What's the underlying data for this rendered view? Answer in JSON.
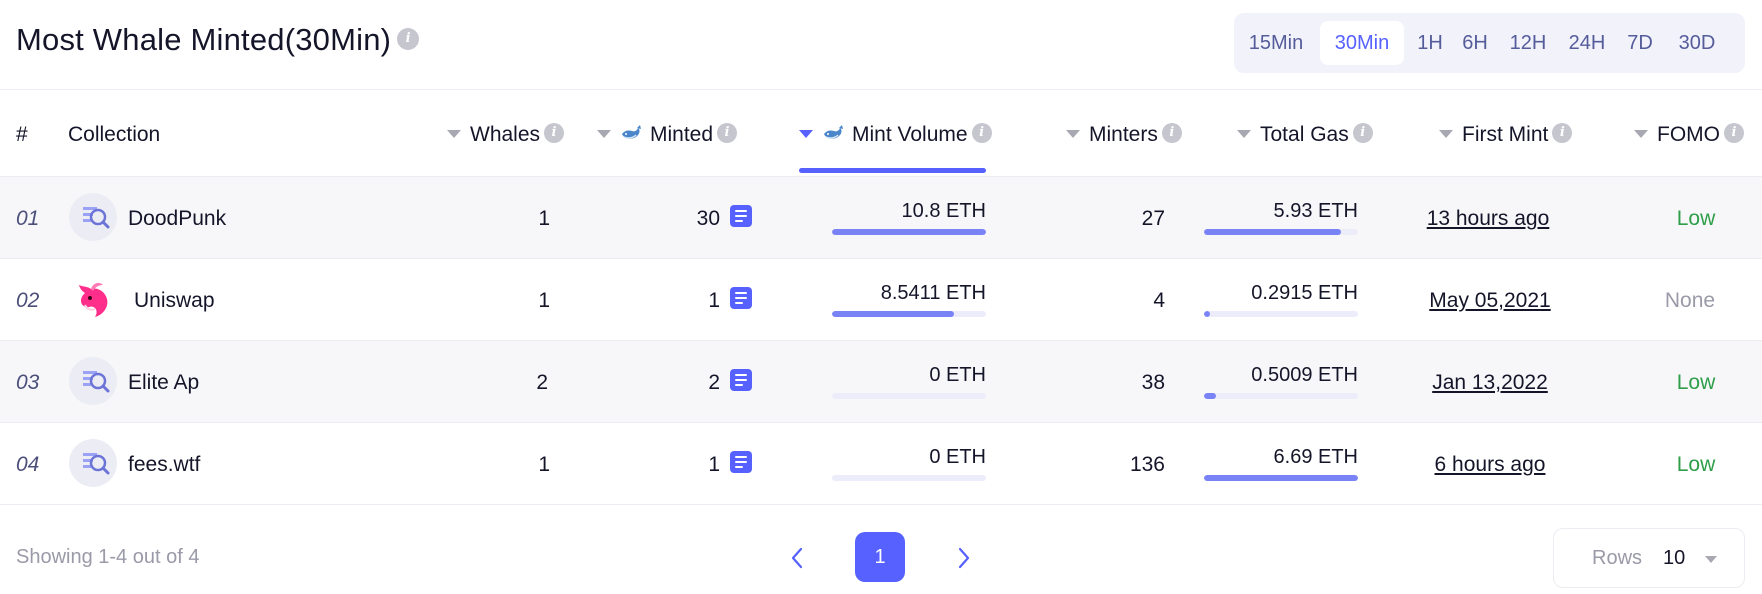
{
  "title": "Most Whale Minted(30Min)",
  "time_filters": [
    "15Min",
    "30Min",
    "1H",
    "6H",
    "12H",
    "24H",
    "7D",
    "30D"
  ],
  "active_time_filter": "30Min",
  "columns": {
    "rank": "#",
    "collection": "Collection",
    "whales": "Whales",
    "minted": "Minted",
    "mint_volume": "Mint Volume",
    "minters": "Minters",
    "total_gas": "Total Gas",
    "first_mint": "First Mint",
    "fomo": "FOMO"
  },
  "sorted_by": "Mint Volume",
  "rows": [
    {
      "rank": "01",
      "collection": "DoodPunk",
      "avatar": "search-icon",
      "whales": "1",
      "minted": "30",
      "mint_volume": "10.8 ETH",
      "mint_volume_share": 1.0,
      "minters": "27",
      "total_gas": "5.93 ETH",
      "total_gas_share": 0.89,
      "first_mint": "13 hours ago",
      "fomo": "Low",
      "fomo_color": "#2e9e49"
    },
    {
      "rank": "02",
      "collection": "Uniswap",
      "avatar": "unicorn-logo",
      "whales": "1",
      "minted": "1",
      "mint_volume": "8.5411 ETH",
      "mint_volume_share": 0.79,
      "minters": "4",
      "total_gas": "0.2915 ETH",
      "total_gas_share": 0.04,
      "first_mint": "May 05,2021",
      "fomo": "None",
      "fomo_color": "#9a9aa8"
    },
    {
      "rank": "03",
      "collection": "Elite Ap",
      "avatar": "search-icon",
      "whales": "2",
      "minted": "2",
      "mint_volume": "0 ETH",
      "mint_volume_share": 0.0,
      "minters": "38",
      "total_gas": "0.5009 ETH",
      "total_gas_share": 0.08,
      "first_mint": "Jan 13,2022",
      "fomo": "Low",
      "fomo_color": "#2e9e49"
    },
    {
      "rank": "04",
      "collection": "fees.wtf",
      "avatar": "search-icon",
      "whales": "1",
      "minted": "1",
      "mint_volume": "0 ETH",
      "mint_volume_share": 0.0,
      "minters": "136",
      "total_gas": "6.69 ETH",
      "total_gas_share": 1.0,
      "first_mint": "6 hours ago",
      "fomo": "Low",
      "fomo_color": "#2e9e49"
    }
  ],
  "footer": {
    "showing": "Showing 1-4 out of 4",
    "current_page": "1",
    "rows_label": "Rows",
    "rows_value": "10"
  },
  "colors": {
    "accent": "#5661ff",
    "bar": "#7a83f5",
    "low": "#2e9e49",
    "none": "#9a9aa8"
  }
}
